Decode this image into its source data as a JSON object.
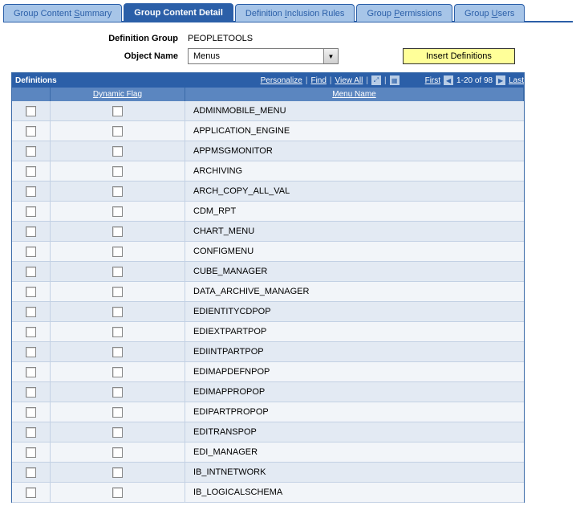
{
  "tabs": [
    {
      "pre": "Group Content ",
      "u": "S",
      "post": "ummary"
    },
    {
      "pre": "",
      "u": "",
      "post": "Group Content Detail"
    },
    {
      "pre": "Definition ",
      "u": "I",
      "post": "nclusion Rules"
    },
    {
      "pre": "Group ",
      "u": "P",
      "post": "ermissions"
    },
    {
      "pre": "Group ",
      "u": "U",
      "post": "sers"
    }
  ],
  "fields": {
    "def_group_label": "Definition Group",
    "def_group_value": "PEOPLETOOLS",
    "obj_name_label": "Object Name",
    "obj_name_value": "Menus",
    "insert_label": "Insert Definitions"
  },
  "grid": {
    "title": "Definitions",
    "actions": {
      "personalize": "Personalize",
      "find": "Find",
      "view_all": "View All"
    },
    "nav": {
      "first": "First",
      "range": "1-20",
      "of": "of",
      "total": "98",
      "last": "Last"
    },
    "headers": {
      "dynamic_flag": "Dynamic Flag",
      "menu_name": "Menu Name"
    },
    "rows": [
      "ADMINMOBILE_MENU",
      "APPLICATION_ENGINE",
      "APPMSGMONITOR",
      "ARCHIVING",
      "ARCH_COPY_ALL_VAL",
      "CDM_RPT",
      "CHART_MENU",
      "CONFIGMENU",
      "CUBE_MANAGER",
      "DATA_ARCHIVE_MANAGER",
      "EDIENTITYCDPOP",
      "EDIEXTPARTPOP",
      "EDIINTPARTPOP",
      "EDIMAPDEFNPOP",
      "EDIMAPPROPOP",
      "EDIPARTPROPOP",
      "EDITRANSPOP",
      "EDI_MANAGER",
      "IB_INTNETWORK",
      "IB_LOGICALSCHEMA"
    ]
  }
}
